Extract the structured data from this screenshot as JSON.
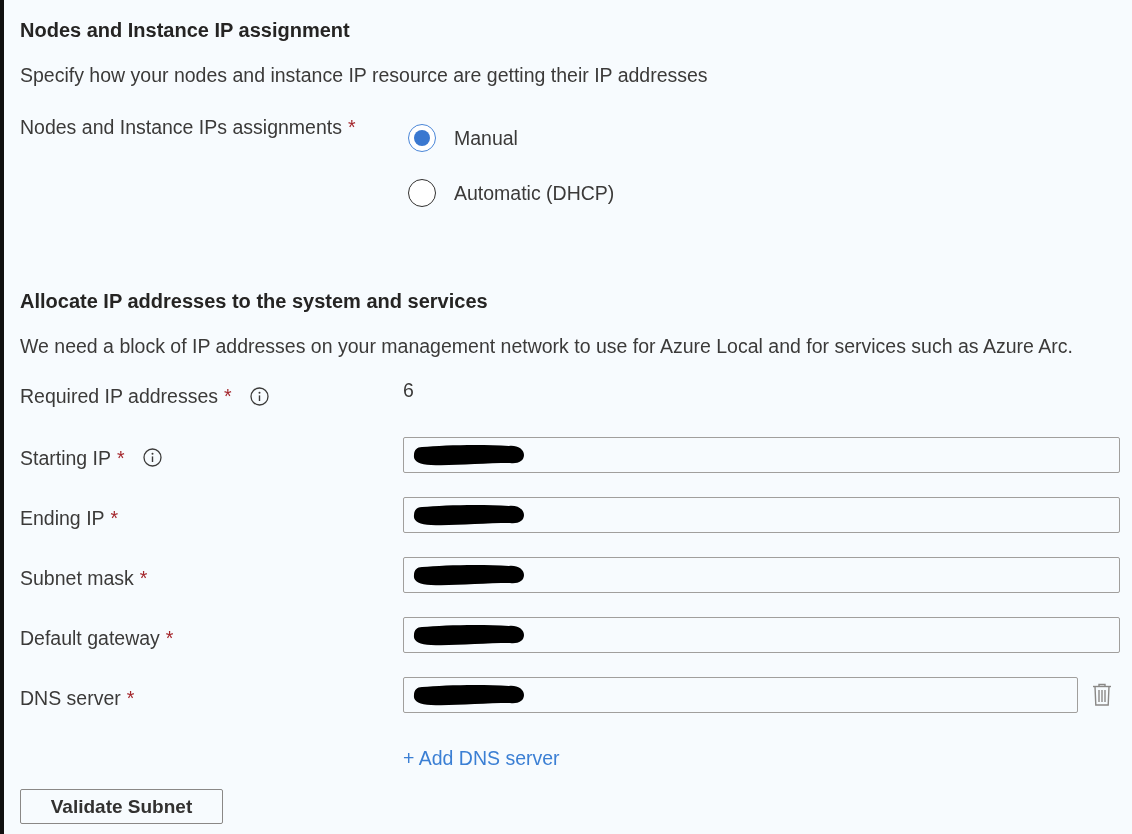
{
  "sections": [
    {
      "title": "Nodes and Instance IP assignment",
      "description": "Specify how your nodes and instance IP resource are getting their IP addresses",
      "fields": [
        {
          "kind": "radio",
          "label": "Nodes and Instance IPs assignments",
          "required_mark": "*",
          "info": false,
          "deletable": false,
          "options": [
            {
              "label": "Manual",
              "selected": true
            },
            {
              "label": "Automatic (DHCP)",
              "selected": false
            }
          ]
        }
      ]
    },
    {
      "title": "Allocate IP addresses to the system and services",
      "description": "We need a block of IP addresses on your management network to use for Azure Local and for services such as Azure Arc.",
      "fields": [
        {
          "kind": "readonly",
          "label": "Required IP addresses",
          "required_mark": "*",
          "info": true,
          "deletable": false,
          "value": "6"
        },
        {
          "kind": "input",
          "label": "Starting IP",
          "required_mark": "*",
          "info": true,
          "deletable": false,
          "value_redacted": true
        },
        {
          "kind": "input",
          "label": "Ending IP",
          "required_mark": "*",
          "info": false,
          "deletable": false,
          "value_redacted": true
        },
        {
          "kind": "input",
          "label": "Subnet mask",
          "required_mark": "*",
          "info": false,
          "deletable": false,
          "value_redacted": true
        },
        {
          "kind": "input",
          "label": "Default gateway",
          "required_mark": "*",
          "info": false,
          "deletable": false,
          "value_redacted": true
        },
        {
          "kind": "input",
          "label": "DNS server",
          "required_mark": "*",
          "info": false,
          "deletable": true,
          "value_redacted": true
        }
      ],
      "add_link": {
        "label": "+ Add DNS server"
      }
    }
  ],
  "buttons": [
    {
      "label": "Validate Subnet"
    }
  ]
}
